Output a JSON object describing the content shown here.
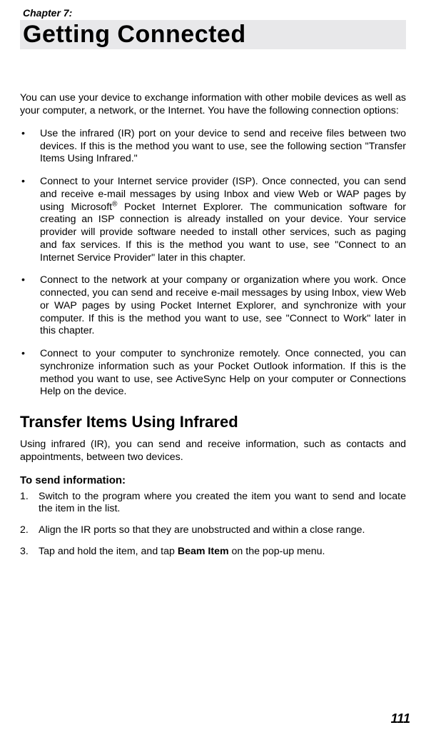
{
  "chapter_label": "Chapter 7:",
  "main_title": "Getting Connected",
  "intro": "You can use your device to exchange information with other mobile devices as well as your computer, a network, or the Internet. You have the following connection options:",
  "bullets": [
    {
      "pre": "Use the infrared (IR) port on your device to send and receive files between two devices. If this is the method you want to use, see the following section \"Transfer Items Using Infrared.\"",
      "sup": "",
      "post": ""
    },
    {
      "pre": "Connect to your Internet service provider (ISP). Once connected, you can send and receive e-mail messages by using Inbox and view Web or WAP pages by using Microsoft",
      "sup": "®",
      "post": " Pocket Internet Explorer. The communication software for creating an ISP connection is already installed on your device. Your service provider will provide software needed to install other services, such as paging and fax services. If this is the method you want to use, see \"Connect to an Internet Service Provider\" later in this chapter."
    },
    {
      "pre": "Connect to the network at your company or organization where you work. Once connected, you can send and receive e-mail messages by using Inbox, view Web or WAP pages by using Pocket Internet Explorer, and synchronize with your computer. If this is the method you want to use, see \"Connect to Work\" later in this chapter.",
      "sup": "",
      "post": ""
    },
    {
      "pre": "Connect to your computer to synchronize remotely. Once connected, you can synchronize information such as your Pocket Outlook information. If this is the method you want to use, see ActiveSync Help on your computer or Connections Help on the device.",
      "sup": "",
      "post": ""
    }
  ],
  "section_title": "Transfer Items Using Infrared",
  "section_intro": "Using infrared (IR), you can send and receive information, such as contacts and appointments, between two devices.",
  "subhead": "To send information:",
  "steps": [
    {
      "num": "1.",
      "text_pre": "Switch to the program where you created the item you want to send and locate the item in the list.",
      "bold": "",
      "text_post": ""
    },
    {
      "num": "2.",
      "text_pre": "Align the IR ports so that they are unobstructed and within a close range.",
      "bold": "",
      "text_post": ""
    },
    {
      "num": "3.",
      "text_pre": "Tap and hold the item, and tap ",
      "bold": "Beam Item",
      "text_post": " on the pop-up menu."
    }
  ],
  "page_number": "111"
}
